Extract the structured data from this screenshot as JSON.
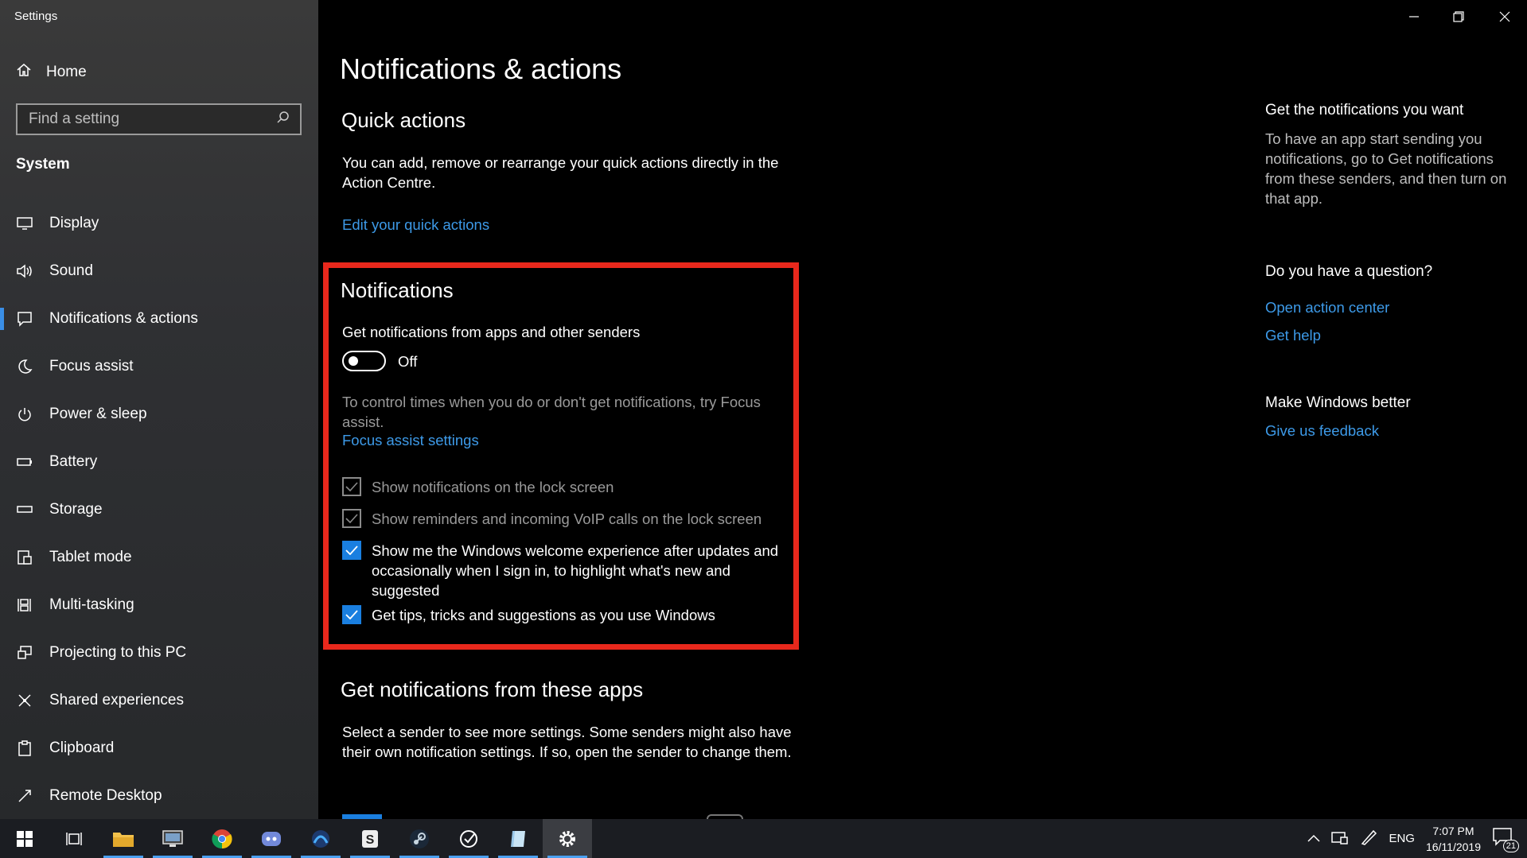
{
  "window": {
    "title": "Settings"
  },
  "sidebar": {
    "home_label": "Home",
    "search_placeholder": "Find a setting",
    "section": "System",
    "items": [
      {
        "label": "Display",
        "icon": "monitor-icon"
      },
      {
        "label": "Sound",
        "icon": "speaker-icon"
      },
      {
        "label": "Notifications & actions",
        "icon": "message-icon",
        "active": true
      },
      {
        "label": "Focus assist",
        "icon": "moon-icon"
      },
      {
        "label": "Power & sleep",
        "icon": "power-icon"
      },
      {
        "label": "Battery",
        "icon": "battery-icon"
      },
      {
        "label": "Storage",
        "icon": "storage-icon"
      },
      {
        "label": "Tablet mode",
        "icon": "tablet-icon"
      },
      {
        "label": "Multi-tasking",
        "icon": "multitask-icon"
      },
      {
        "label": "Projecting to this PC",
        "icon": "project-icon"
      },
      {
        "label": "Shared experiences",
        "icon": "share-icon"
      },
      {
        "label": "Clipboard",
        "icon": "clipboard-icon"
      },
      {
        "label": "Remote Desktop",
        "icon": "remote-icon"
      }
    ]
  },
  "main": {
    "title": "Notifications & actions",
    "quick_actions": {
      "heading": "Quick actions",
      "description": "You can add, remove or rearrange your quick actions directly in the Action Centre.",
      "link": "Edit your quick actions"
    },
    "notifications": {
      "heading": "Notifications",
      "toggle_label": "Get notifications from apps and other senders",
      "toggle_state": "Off",
      "focus_text": "To control times when you do or don't get notifications, try Focus assist.",
      "focus_link": "Focus assist settings",
      "checkboxes": [
        {
          "label": "Show notifications on the lock screen",
          "checked": true,
          "disabled": true
        },
        {
          "label": "Show reminders and incoming VoIP calls on the lock screen",
          "checked": true,
          "disabled": true
        },
        {
          "label": "Show me the Windows welcome experience after updates and occasionally when I sign in, to highlight what's new and suggested",
          "checked": true,
          "disabled": false
        },
        {
          "label": "Get tips, tricks and suggestions as you use Windows",
          "checked": true,
          "disabled": false
        }
      ]
    },
    "apps": {
      "heading": "Get notifications from these apps",
      "description": "Select a sender to see more settings. Some senders might also have their own notification settings. If so, open the sender to change them."
    }
  },
  "right": {
    "section1": {
      "heading": "Get the notifications you want",
      "text": "To have an app start sending you notifications, go to Get notifications from these senders, and then turn on that app."
    },
    "section2": {
      "heading": "Do you have a question?",
      "links": [
        "Open action center",
        "Get help"
      ]
    },
    "section3": {
      "heading": "Make Windows better",
      "link": "Give us feedback"
    }
  },
  "taskbar": {
    "apps": [
      "start-icon",
      "task-view-icon",
      "file-explorer-icon",
      "remote-desktop-app-icon",
      "chrome-icon",
      "discord-icon",
      "app-blue-icon",
      "app-s-icon",
      "steam-icon",
      "app-check-icon",
      "app-notepad-icon",
      "settings-gear-icon"
    ],
    "language": "ENG",
    "time": "7:07 PM",
    "date": "16/11/2019",
    "notification_count": "21"
  },
  "colors": {
    "accent": "#1a7fe0",
    "link": "#3d9ae8",
    "highlight": "#e8281c"
  }
}
